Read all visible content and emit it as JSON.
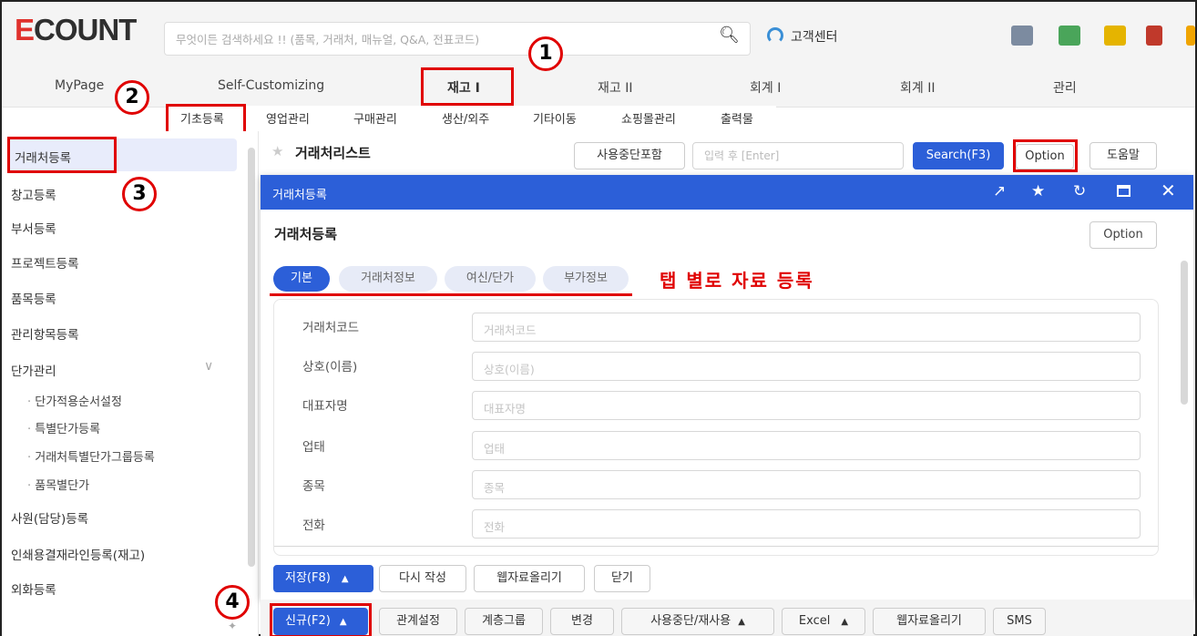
{
  "header": {
    "logo_text": "ECOUNT",
    "search_placeholder": "무엇이든 검색하세요 !! (품목, 거래처, 매뉴얼, Q&A, 전표코드)",
    "customer_center": "고객센터"
  },
  "menu": {
    "items": [
      "MyPage",
      "Self-Customizing",
      "재고 I",
      "재고 II",
      "회계 I",
      "회계 II",
      "관리"
    ]
  },
  "subnav": {
    "items": [
      "기초등록",
      "영업관리",
      "구매관리",
      "생산/외주",
      "기타이동",
      "쇼핑몰관리",
      "출력물"
    ]
  },
  "sidebar": {
    "items": [
      "거래처등록",
      "창고등록",
      "부서등록",
      "프로젝트등록",
      "품목등록",
      "관리항목등록",
      "단가관리"
    ],
    "sub_items": [
      "단가적용순서설정",
      "특별단가등록",
      "거래처특별단가그룹등록",
      "품목별단가"
    ],
    "items_after": [
      "사원(담당)등록",
      "인쇄용결재라인등록(재고)",
      "외화등록"
    ]
  },
  "list_header": {
    "title": "거래처리스트",
    "include_stopped": "사용중단포함",
    "input_placeholder": "입력 후 [Enter]",
    "search": "Search(F3)",
    "option": "Option",
    "help": "도움말"
  },
  "modal": {
    "bar_title": "거래처등록",
    "form_title": "거래처등록",
    "option": "Option",
    "tabs": [
      "기본",
      "거래처정보",
      "여신/단가",
      "부가정보"
    ],
    "tab_annotation": "탭 별로 자료 등록",
    "fields": [
      {
        "label": "거래처코드",
        "placeholder": "거래처코드"
      },
      {
        "label": "상호(이름)",
        "placeholder": "상호(이름)"
      },
      {
        "label": "대표자명",
        "placeholder": "대표자명"
      },
      {
        "label": "업태",
        "placeholder": "업태"
      },
      {
        "label": "종목",
        "placeholder": "종목"
      },
      {
        "label": "전화",
        "placeholder": "전화"
      }
    ],
    "footer_buttons": {
      "save": "저장(F8)",
      "rewrite": "다시 작성",
      "web_upload": "웹자료올리기",
      "close": "닫기"
    }
  },
  "bottom_bar": {
    "new": "신규(F2)",
    "relation": "관계설정",
    "hierarchy": "계층그룹",
    "change": "변경",
    "stop_reuse": "사용중단/재사용",
    "excel": "Excel",
    "web_upload": "웹자료올리기",
    "sms": "SMS"
  },
  "annotations": [
    "1",
    "2",
    "3",
    "4"
  ],
  "colors": {
    "accent": "#2c5fd8",
    "highlight": "#e00000"
  }
}
